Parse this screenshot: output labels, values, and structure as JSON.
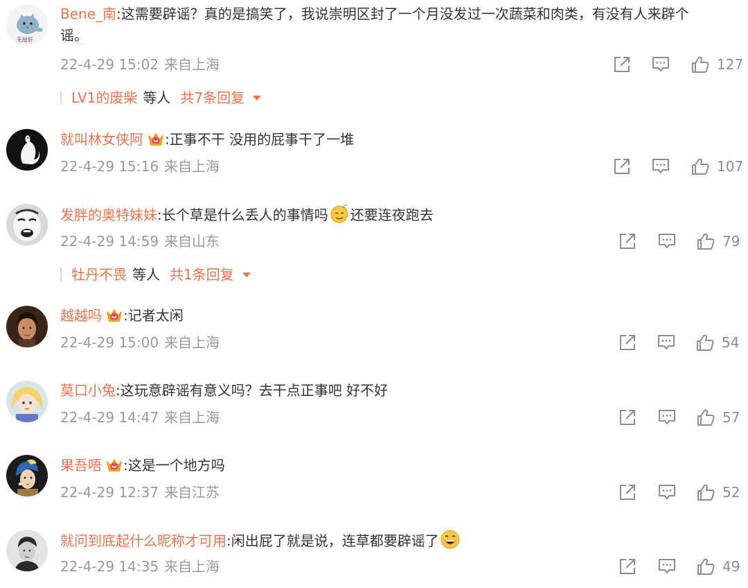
{
  "comments": [
    {
      "username": "Bene_南",
      "avatar_icon": "blue-cat-avatar",
      "avatar_caption": "无敌虾",
      "has_badge": false,
      "text_line1": ":这需要辟谣？真的是搞笑了，我说崇明区封了一个月没发过一次蔬菜和肉类，有没有人来辟个",
      "text_line2": "谣。",
      "date": "22-4-29 15:02",
      "source": "来自上海",
      "likes": "127",
      "replies": {
        "name": "LV1的废柴",
        "deng": "等人",
        "total": "共7条回复"
      }
    },
    {
      "username": "就叫林女侠阿",
      "avatar_icon": "black-cat-avatar",
      "has_badge": true,
      "text": ":正事不干 没用的屁事干了一堆",
      "date": "22-4-29 15:16",
      "source": "来自上海",
      "likes": "107"
    },
    {
      "username": "发胖的奥特妹妹",
      "avatar_icon": "meme-face-avatar",
      "has_badge": false,
      "text_before_emoji": ":长个草是什么丢人的事情吗",
      "emoji": "sleepy-emoji",
      "text_after_emoji": "还要连夜跑去",
      "date": "22-4-29 14:59",
      "source": "来自山东",
      "likes": "79",
      "replies": {
        "name": "牡丹不畏",
        "deng": "等人",
        "total": "共1条回复"
      }
    },
    {
      "username": "越越吗",
      "avatar_icon": "man-photo-avatar",
      "has_badge": true,
      "text": ":记者太闲",
      "date": "22-4-29 15:00",
      "source": "来自上海",
      "likes": "54"
    },
    {
      "username": "莫口小兔",
      "avatar_icon": "anime-girl-avatar",
      "has_badge": false,
      "text": ":这玩意辟谣有意义吗？去干点正事吧 好不好",
      "date": "22-4-29 14:47",
      "source": "来自上海",
      "likes": "57"
    },
    {
      "username": "果吾唔",
      "avatar_icon": "pearl-earring-avatar",
      "has_badge": true,
      "text": ":这是一个地方吗",
      "date": "22-4-29 12:37",
      "source": "来自江苏",
      "likes": "52"
    },
    {
      "username": "就问到底起什么昵称才可用",
      "avatar_icon": "grayscale-man-avatar",
      "has_badge": false,
      "text": ":闲出屁了就是说，连草都要辟谣了",
      "emoji": "laughing-emoji",
      "date": "22-4-29 14:35",
      "source": "来自上海",
      "likes": "49"
    }
  ],
  "colors": {
    "username": "#eb7350",
    "meta": "#9a9a9a",
    "text": "#333333",
    "icon": "#8d8d8d"
  }
}
